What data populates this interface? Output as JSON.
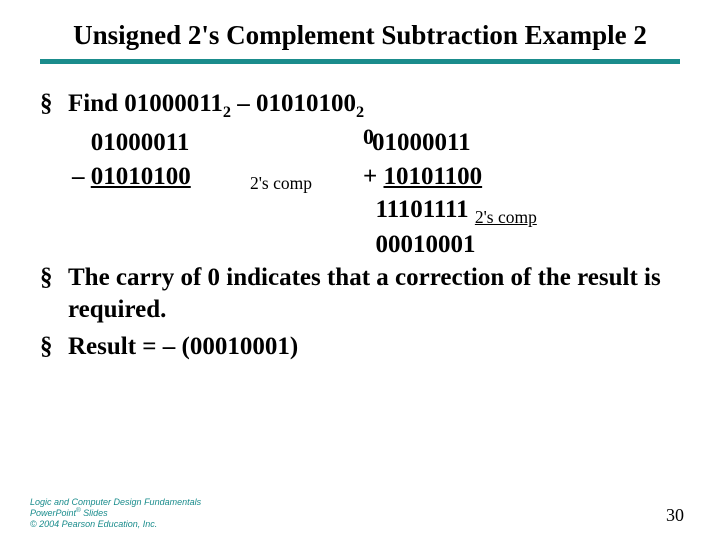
{
  "title": "Unsigned 2's Complement Subtraction Example 2",
  "bullets": {
    "b1_prefix": "Find ",
    "b1_num1": "01000011",
    "b1_sub1": "2",
    "b1_mid": " – ",
    "b1_num2": "01010100",
    "b1_sub2": "2",
    "b2": "The carry of 0 indicates that a correction of the result is required.",
    "b3": "Result = – (00010001)"
  },
  "math": {
    "minus": "–",
    "a": "01000011",
    "b": "01010100",
    "compLabel": "2's comp",
    "carry": "0",
    "a2": "01000011",
    "plus": "+ ",
    "b2c": "10101100",
    "sum": "11101111",
    "compLabel2": "2's comp",
    "final": "00010001"
  },
  "footer": {
    "l1": "Logic and Computer Design Fundamentals",
    "l2a": "PowerPoint",
    "l2r": "®",
    "l2b": " Slides",
    "l3": "© 2004 Pearson Education, Inc."
  },
  "page": "30"
}
